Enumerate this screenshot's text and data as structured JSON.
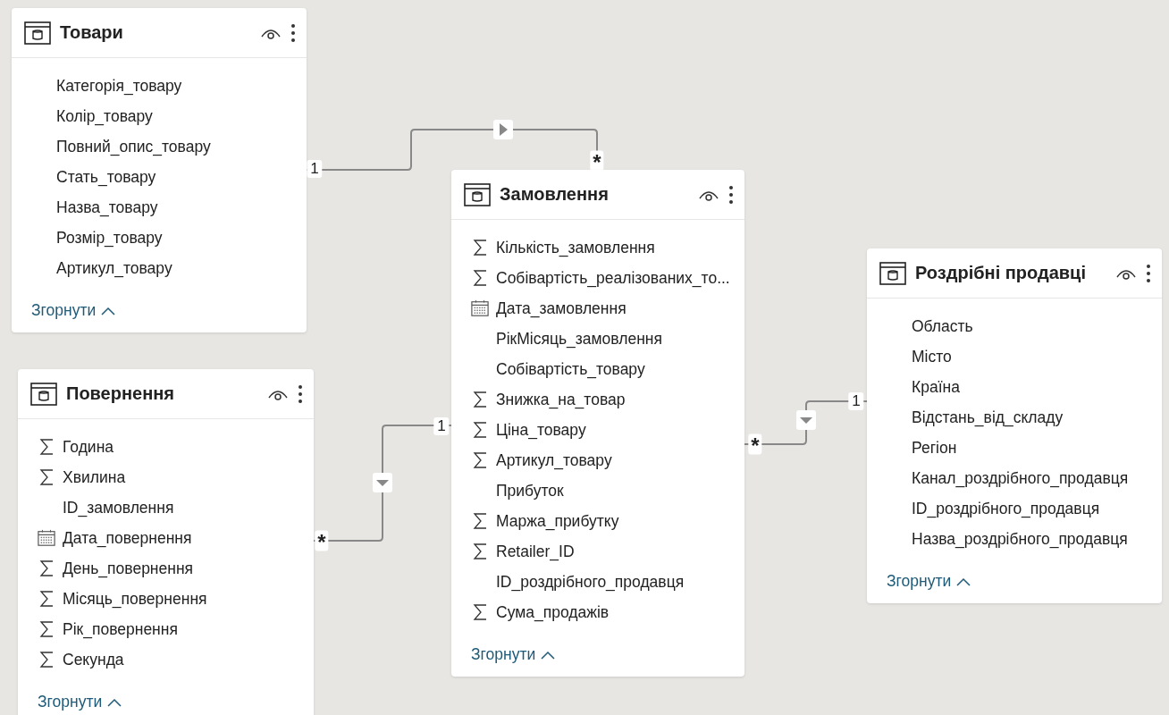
{
  "tables": [
    {
      "name": "Товари",
      "fields": [
        {
          "name": "Категорія_товару",
          "kind": "plain"
        },
        {
          "name": "Колір_товару",
          "kind": "plain"
        },
        {
          "name": "Повний_опис_товару",
          "kind": "plain"
        },
        {
          "name": "Стать_товару",
          "kind": "plain"
        },
        {
          "name": "Назва_товару",
          "kind": "plain"
        },
        {
          "name": "Розмір_товару",
          "kind": "plain"
        },
        {
          "name": "Артикул_товару",
          "kind": "plain"
        }
      ],
      "collapse": "Згорнути"
    },
    {
      "name": "Повернення",
      "fields": [
        {
          "name": "Година",
          "kind": "sum"
        },
        {
          "name": "Хвилина",
          "kind": "sum"
        },
        {
          "name": "ID_замовлення",
          "kind": "plain"
        },
        {
          "name": "Дата_повернення",
          "kind": "date"
        },
        {
          "name": "День_повернення",
          "kind": "sum"
        },
        {
          "name": "Місяць_повернення",
          "kind": "sum"
        },
        {
          "name": "Рік_повернення",
          "kind": "sum"
        },
        {
          "name": "Секунда",
          "kind": "sum"
        }
      ],
      "collapse": "Згорнути"
    },
    {
      "name": "Замовлення",
      "fields": [
        {
          "name": "Кількість_замовлення",
          "kind": "sum"
        },
        {
          "name": "Собівартість_реалізованих_то...",
          "kind": "sum"
        },
        {
          "name": "Дата_замовлення",
          "kind": "date"
        },
        {
          "name": "РікМісяць_замовлення",
          "kind": "plain"
        },
        {
          "name": "Собівартість_товару",
          "kind": "plain"
        },
        {
          "name": "Знижка_на_товар",
          "kind": "sum"
        },
        {
          "name": "Ціна_товару",
          "kind": "sum"
        },
        {
          "name": "Артикул_товару",
          "kind": "sum"
        },
        {
          "name": "Прибуток",
          "kind": "plain"
        },
        {
          "name": "Маржа_прибутку",
          "kind": "sum"
        },
        {
          "name": "Retailer_ID",
          "kind": "sum"
        },
        {
          "name": "ID_роздрібного_продавця",
          "kind": "plain"
        },
        {
          "name": "Сума_продажів",
          "kind": "sum"
        }
      ],
      "collapse": "Згорнути"
    },
    {
      "name": "Роздрібні продавці",
      "fields": [
        {
          "name": "Область",
          "kind": "plain"
        },
        {
          "name": "Місто",
          "kind": "plain"
        },
        {
          "name": "Країна",
          "kind": "plain"
        },
        {
          "name": "Відстань_від_складу",
          "kind": "plain"
        },
        {
          "name": "Регіон",
          "kind": "plain"
        },
        {
          "name": "Канал_роздрібного_продавця",
          "kind": "plain"
        },
        {
          "name": "ID_роздрібного_продавця",
          "kind": "plain"
        },
        {
          "name": "Назва_роздрібного_продавця",
          "kind": "plain"
        }
      ],
      "collapse": "Згорнути"
    }
  ],
  "relationships": [
    {
      "one_label": "1",
      "many_label": "*",
      "kind": "right"
    },
    {
      "one_label": "1",
      "many_label": "*",
      "kind": "down"
    },
    {
      "one_label": "1",
      "many_label": "*",
      "kind": "down"
    }
  ]
}
